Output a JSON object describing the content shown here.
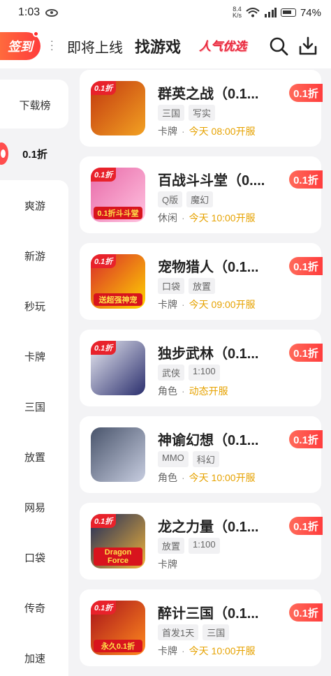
{
  "status_bar": {
    "time": "1:03",
    "speed_top": "8.4",
    "speed_bottom": "K/s",
    "battery": "74%"
  },
  "header": {
    "signin_label": "签到",
    "tabs": [
      {
        "label": "即将上线"
      },
      {
        "label": "找游戏"
      },
      {
        "label": "人气优选"
      }
    ]
  },
  "sidebar": {
    "items": [
      {
        "label": "下载榜"
      },
      {
        "label": "0.1折"
      },
      {
        "label": "爽游"
      },
      {
        "label": "新游"
      },
      {
        "label": "秒玩"
      },
      {
        "label": "卡牌"
      },
      {
        "label": "三国"
      },
      {
        "label": "放置"
      },
      {
        "label": "网易"
      },
      {
        "label": "口袋"
      },
      {
        "label": "传奇"
      },
      {
        "label": "加速"
      }
    ],
    "active_index": 1
  },
  "games": [
    {
      "name": "群英之战（0.1...",
      "tags": [
        "三国",
        "写实"
      ],
      "category": "卡牌",
      "open_time": "今天 08:00开服",
      "discount": "0.1折",
      "thumb_badge": "0.1折",
      "thumb_banner": "",
      "colors": [
        "#c2380f",
        "#f2a122"
      ]
    },
    {
      "name": "百战斗斗堂（0....",
      "tags": [
        "Q版",
        "魔幻"
      ],
      "category": "休闲",
      "open_time": "今天 10:00开服",
      "discount": "0.1折",
      "thumb_badge": "0.1折",
      "thumb_banner": "0.1折斗斗堂",
      "colors": [
        "#e86aa8",
        "#ffc2e0"
      ]
    },
    {
      "name": "宠物猎人（0.1...",
      "tags": [
        "口袋",
        "放置"
      ],
      "category": "卡牌",
      "open_time": "今天 09:00开服",
      "discount": "0.1折",
      "thumb_badge": "0.1折",
      "thumb_banner": "送超强神宠",
      "colors": [
        "#d92a2a",
        "#ffd400"
      ]
    },
    {
      "name": "独步武林（0.1...",
      "tags": [
        "武侠",
        "1:100"
      ],
      "category": "角色",
      "open_time": "动态开服",
      "discount": "0.1折",
      "thumb_badge": "0.1折",
      "thumb_banner": "",
      "colors": [
        "#e9eaf2",
        "#2b2f6e"
      ]
    },
    {
      "name": "神谕幻想（0.1...",
      "tags": [
        "MMO",
        "科幻"
      ],
      "category": "角色",
      "open_time": "今天 10:00开服",
      "discount": "0.1折",
      "thumb_badge": "",
      "thumb_banner": "",
      "colors": [
        "#49546b",
        "#c7cde0"
      ]
    },
    {
      "name": "龙之力量（0.1...",
      "tags": [
        "放置",
        "1:100"
      ],
      "category": "卡牌",
      "open_time": "",
      "discount": "0.1折",
      "thumb_badge": "0.1折",
      "thumb_banner": "Dragon Force",
      "colors": [
        "#1d2a5a",
        "#f0b33a"
      ]
    },
    {
      "name": "醉计三国（0.1...",
      "tags": [
        "首发1天",
        "三国"
      ],
      "category": "卡牌",
      "open_time": "今天 10:00开服",
      "discount": "0.1折",
      "thumb_badge": "0.1折",
      "thumb_banner": "永久0.1折",
      "colors": [
        "#a8121a",
        "#ff8a1e"
      ]
    }
  ]
}
